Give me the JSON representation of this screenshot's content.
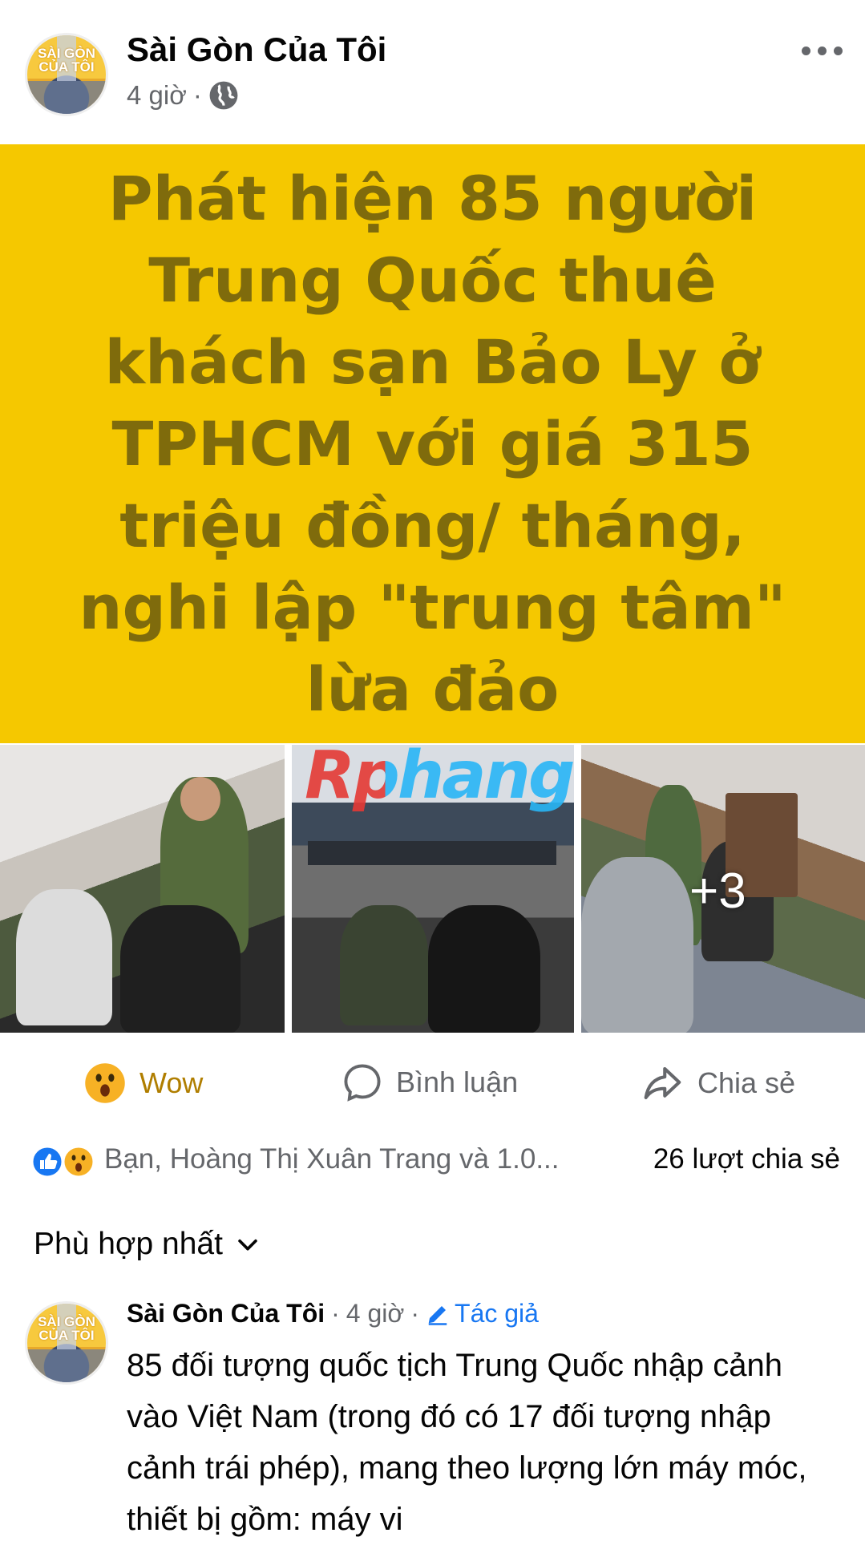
{
  "header": {
    "page_name": "Sài Gòn Của Tôi",
    "avatar_text": "SÀI GÒN CỦA TÔI",
    "time": "4 giờ",
    "separator": "·",
    "privacy_icon": "globe-icon",
    "menu_icon": "more-horizontal-icon"
  },
  "post": {
    "headline": "Phát hiện 85 người Trung Quốc thuê khách sạn Bảo Ly ở TPHCM với giá 315 triệu đồng/ tháng, nghi lập \"trung tâm\" lừa đảo",
    "banner_color": "#f5c800",
    "headline_color": "#7f6b0c",
    "watermark": "Rphang",
    "extra_photos": "+3"
  },
  "actions": {
    "reaction_label": "Wow",
    "comment_label": "Bình luận",
    "share_label": "Chia sẻ",
    "reaction_color": "#b07e00"
  },
  "summary": {
    "reaction_icons": [
      "like-icon",
      "wow-icon"
    ],
    "reactors": "Bạn, Hoàng Thị Xuân Trang và 1.0...",
    "shares": "26 lượt chia sẻ"
  },
  "comments": {
    "sort_label": "Phù hợp nhất",
    "items": [
      {
        "author": "Sài Gòn Của Tôi",
        "time": "4 giờ",
        "badge": "Tác giả",
        "text": "85 đối tượng quốc tịch Trung Quốc nhập cảnh vào Việt Nam (trong đó có 17 đối tượng nhập cảnh trái phép), mang theo lượng lớn máy móc, thiết bị gồm: máy vi"
      }
    ]
  }
}
